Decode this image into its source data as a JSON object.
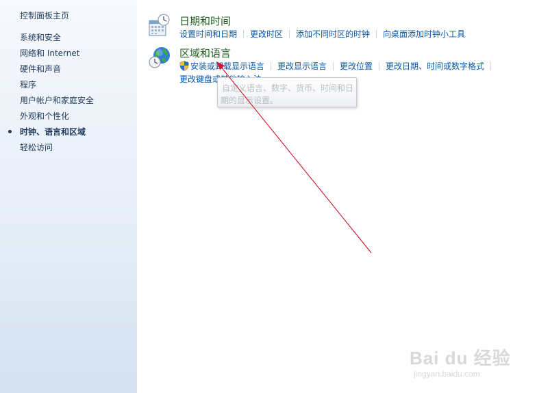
{
  "sidebar": {
    "home_label": "控制面板主页",
    "items": [
      {
        "label": "系统和安全",
        "active": false
      },
      {
        "label": "网络和 Internet",
        "active": false
      },
      {
        "label": "硬件和声音",
        "active": false
      },
      {
        "label": "程序",
        "active": false
      },
      {
        "label": "用户帐户和家庭安全",
        "active": false
      },
      {
        "label": "外观和个性化",
        "active": false
      },
      {
        "label": "时钟、语言和区域",
        "active": true
      },
      {
        "label": "轻松访问",
        "active": false
      }
    ]
  },
  "categories": [
    {
      "title": "日期和时间",
      "icon": "calendar-clock-icon",
      "links": [
        "设置时间和日期",
        "更改时区",
        "添加不同时区的时钟",
        "向桌面添加时钟小工具"
      ]
    },
    {
      "title": "区域和语言",
      "icon": "globe-clock-icon",
      "links_row1": [
        "安装或卸载显示语言",
        "更改显示语言",
        "更改位置",
        "更改日期、时间或数字格式"
      ],
      "links_row2": [
        "更改键盘或其他输入法"
      ],
      "shield_icon": "uac-shield-icon"
    }
  ],
  "tooltip": {
    "line1": "自定义语言、数字、货币、时间和日",
    "line2": "期的显示设置。"
  },
  "watermark": {
    "logo": "Bai du 经验",
    "url": "jingyan.baidu.com"
  },
  "colors": {
    "link": "#0a58a8",
    "category_title": "#1e5e1e",
    "sidebar_text": "#1e395b",
    "annotation_arrow": "#d0142c"
  }
}
